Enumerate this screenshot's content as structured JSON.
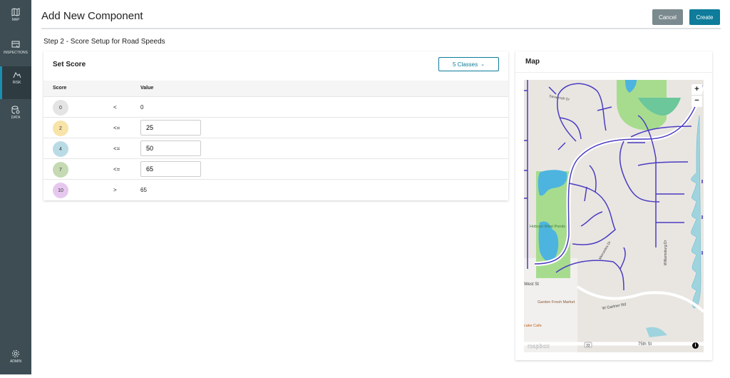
{
  "sidebar": {
    "items": [
      {
        "label": "MAP",
        "icon": "map-icon"
      },
      {
        "label": "INSPECTIONS",
        "icon": "inspections-icon"
      },
      {
        "label": "RISK",
        "icon": "risk-icon",
        "active": true
      },
      {
        "label": "DATA",
        "icon": "data-icon"
      },
      {
        "label": "ADMIN",
        "icon": "gear-icon"
      }
    ]
  },
  "header": {
    "title": "Add New Component",
    "cancel_label": "Cancel",
    "create_label": "Create"
  },
  "step": "Step 2 - Score Setup for Road Speeds",
  "score": {
    "title": "Set Score",
    "classes_label": "5 Classes",
    "col_score": "Score",
    "col_value": "Value",
    "rows": [
      {
        "score": "0",
        "op": "<",
        "value": "0",
        "editable": false,
        "color": "#e4e4e4"
      },
      {
        "score": "2",
        "op": "<=",
        "value": "25",
        "editable": true,
        "color": "#f8e3a8"
      },
      {
        "score": "4",
        "op": "<=",
        "value": "50",
        "editable": true,
        "color": "#b9dbe5"
      },
      {
        "score": "7",
        "op": "<=",
        "value": "65",
        "editable": true,
        "color": "#c5dab2"
      },
      {
        "score": "10",
        "op": ">",
        "value": "65",
        "editable": false,
        "color": "#e6c8ef"
      }
    ]
  },
  "map": {
    "title": "Map",
    "zoom_in": "+",
    "zoom_out": "−",
    "attribution": "mapbox",
    "labels": {
      "street1": "Savannah Dr",
      "park": "Hobson West Ponds",
      "west": "West St",
      "market": "Garden Fresh Market",
      "gartner": "W Gartner Rd",
      "cafe": "cake Cafe",
      "st75": "75th St",
      "route": "33",
      "street2": "Mercedes Dr",
      "street3": "Williamsburg Dr"
    }
  },
  "colors": {
    "accent": "#0e7c9a",
    "cancel": "#7b8a8f",
    "sidebar": "#3d4d53"
  }
}
